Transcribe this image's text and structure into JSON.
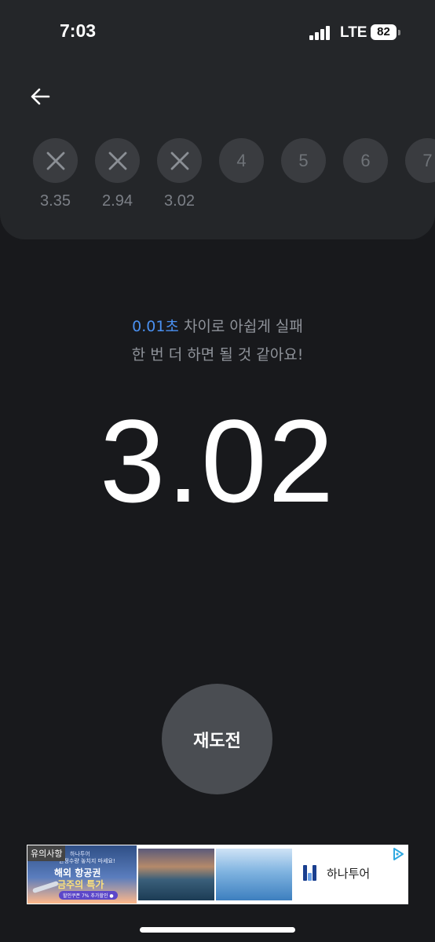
{
  "status_bar": {
    "time": "7:03",
    "network": "LTE",
    "battery": "82"
  },
  "attempts": [
    {
      "status": "fail",
      "icon": "x-icon",
      "time": "3.35"
    },
    {
      "status": "fail",
      "icon": "x-icon",
      "time": "2.94"
    },
    {
      "status": "fail",
      "icon": "x-icon",
      "time": "3.02"
    },
    {
      "status": "pending",
      "label": "4",
      "time": ""
    },
    {
      "status": "pending",
      "label": "5",
      "time": ""
    },
    {
      "status": "pending",
      "label": "6",
      "time": ""
    },
    {
      "status": "pending",
      "label": "7",
      "time": ""
    }
  ],
  "message": {
    "highlight": "0.01초",
    "line1_rest": " 차이로 아쉽게 실패",
    "line2": "한 번 더 하면 될 것 같아요!"
  },
  "result": {
    "time": "3.02"
  },
  "retry_button": {
    "label": "재도전"
  },
  "ad": {
    "tag": "유의사항",
    "logo": "하나투어",
    "subtitle": "한정수량 놓치지 마세요!",
    "headline1": "해외 항공권",
    "headline2": "금주의 특가",
    "button": "할인쿠폰 7% 추가할인 ●",
    "brand_name": "하나투어"
  },
  "colors": {
    "background": "#18191c",
    "panel": "#242629",
    "accent": "#4a90f0",
    "button": "#4a4d52"
  }
}
